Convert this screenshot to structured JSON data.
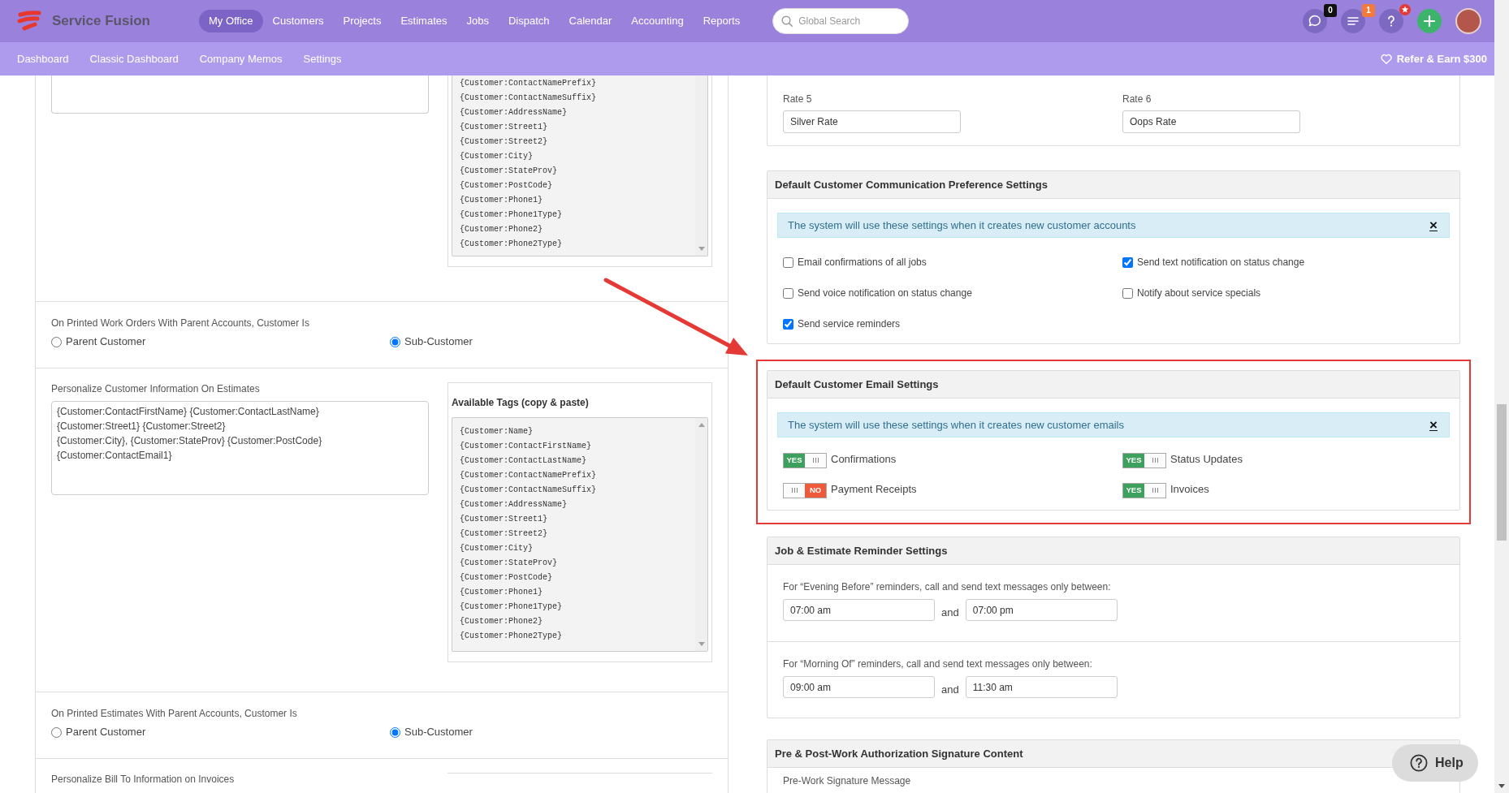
{
  "header": {
    "logo": "Service Fusion",
    "nav": [
      {
        "label": "My Office",
        "selected": true
      },
      {
        "label": "Customers",
        "selected": false
      },
      {
        "label": "Projects",
        "selected": false
      },
      {
        "label": "Estimates",
        "selected": false
      },
      {
        "label": "Jobs",
        "selected": false
      },
      {
        "label": "Dispatch",
        "selected": false
      },
      {
        "label": "Calendar",
        "selected": false
      },
      {
        "label": "Accounting",
        "selected": false
      },
      {
        "label": "Reports",
        "selected": false
      }
    ],
    "search": {
      "placeholder": "Global Search"
    },
    "tools": [
      {
        "kind": "chat",
        "badge": "0",
        "starred": false
      },
      {
        "kind": "tasks",
        "badge": "1",
        "starred": false
      },
      {
        "kind": "help",
        "starred": true
      },
      {
        "kind": "add",
        "starred": false
      }
    ]
  },
  "subnav": {
    "items": [
      {
        "label": "Dashboard",
        "selected": false
      },
      {
        "label": "Classic Dashboard",
        "selected": false
      },
      {
        "label": "Company Memos",
        "selected": false
      },
      {
        "label": "Settings",
        "selected": false
      }
    ],
    "refer": "Refer & Earn $300"
  },
  "left_panel": {
    "sections": [
      {
        "kind": "template",
        "tags": [
          "{Customer:ContactNamePrefix}",
          "{Customer:ContactNameSuffix}",
          "{Customer:AddressName}",
          "{Customer:Street1}",
          "{Customer:Street2}",
          "{Customer:City}",
          "{Customer:StateProv}",
          "{Customer:PostCode}",
          "{Customer:Phone1}",
          "{Customer:Phone1Type}",
          "{Customer:Phone2}",
          "{Customer:Phone2Type}"
        ]
      },
      {
        "kind": "choice",
        "label": "On Printed Work Orders With Parent Accounts, Customer Is",
        "options": [
          {
            "label": "Parent Customer",
            "selected": false
          },
          {
            "label": "Sub-Customer",
            "selected": true
          }
        ]
      },
      {
        "kind": "template",
        "label": "Personalize Customer Information On Estimates",
        "value": "{Customer:ContactFirstName} {Customer:ContactLastName}\n{Customer:Street1} {Customer:Street2}\n{Customer:City}, {Customer:StateProv} {Customer:PostCode}\n{Customer:ContactEmail1}",
        "tags_title": "Available Tags (copy & paste)",
        "tags": [
          "{Customer:Name}",
          "{Customer:ContactFirstName}",
          "{Customer:ContactLastName}",
          "{Customer:ContactNamePrefix}",
          "{Customer:ContactNameSuffix}",
          "{Customer:AddressName}",
          "{Customer:Street1}",
          "{Customer:Street2}",
          "{Customer:City}",
          "{Customer:StateProv}",
          "{Customer:PostCode}",
          "{Customer:Phone1}",
          "{Customer:Phone1Type}",
          "{Customer:Phone2}",
          "{Customer:Phone2Type}"
        ]
      },
      {
        "kind": "choice",
        "label": "On Printed Estimates With Parent Accounts, Customer Is",
        "options": [
          {
            "label": "Parent Customer",
            "selected": false
          },
          {
            "label": "Sub-Customer",
            "selected": true
          }
        ]
      },
      {
        "kind": "label",
        "label": "Personalize Bill To Information on Invoices"
      }
    ]
  },
  "right_panel": {
    "rates": [
      {
        "label": "Rate 5",
        "value": "Silver Rate"
      },
      {
        "label": "Rate 6",
        "value": "Oops Rate"
      }
    ],
    "communication": {
      "title": "Default Customer Communication Preference Settings",
      "notice": "The system will use these settings when it creates new customer accounts",
      "close": "×",
      "options": [
        {
          "label": "Email confirmations of all jobs",
          "checked": false
        },
        {
          "label": "Send text notification on status change",
          "checked": true
        },
        {
          "label": "Send voice notification on status change",
          "checked": false
        },
        {
          "label": "Notify about service specials",
          "checked": false
        },
        {
          "label": "Send service reminders",
          "checked": true
        }
      ]
    },
    "email": {
      "title": "Default Customer Email Settings",
      "highlighted": true,
      "notice": "The system will use these settings when it creates new customer emails",
      "close": "×",
      "toggles": [
        {
          "label": "Confirmations",
          "on": true,
          "state_text": "YES"
        },
        {
          "label": "Status Updates",
          "on": true,
          "state_text": "YES"
        },
        {
          "label": "Payment Receipts",
          "on": false,
          "state_text": "NO"
        },
        {
          "label": "Invoices",
          "on": true,
          "state_text": "YES"
        }
      ]
    },
    "reminders": {
      "title": "Job & Estimate Reminder Settings",
      "windows": [
        {
          "label": "For “Evening Before” reminders, call and send text messages only between:",
          "from": "07:00 am",
          "joiner": "and",
          "to": "07:00 pm"
        },
        {
          "label": "For “Morning Of” reminders, call and send text messages only between:",
          "from": "09:00 am",
          "joiner": "and",
          "to": "11:30 am"
        }
      ]
    },
    "signature": {
      "title": "Pre & Post-Work Authorization Signature Content",
      "field_label": "Pre-Work Signature Message"
    }
  },
  "help_button": "Help"
}
